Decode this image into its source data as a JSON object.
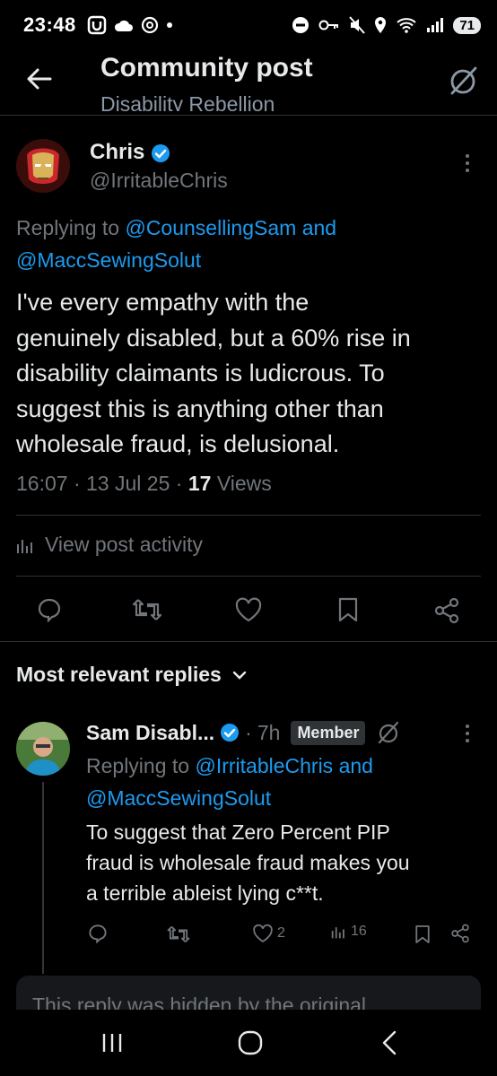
{
  "status_bar": {
    "time": "23:48",
    "battery": "71"
  },
  "header": {
    "title": "Community post",
    "subtitle": "Disability Rebellion"
  },
  "post": {
    "author_name": "Chris",
    "author_handle": "@IrritableChris",
    "replying_label": "Replying to",
    "replying_mention_1": "@CounsellingSam",
    "replying_and": "and",
    "replying_mention_2": "@MaccSewingSolut",
    "text_lines": [
      "I've every empathy with the",
      "genuinely disabled, but a 60% rise in",
      "disability claimants is ludicrous.  To",
      "suggest this is anything other than",
      "wholesale fraud, is delusional."
    ],
    "time": "16:07",
    "date": "13 Jul 25",
    "views_count": "17",
    "views_label": "Views",
    "sep": "·",
    "activity_label": "View post activity"
  },
  "replies_header": {
    "label": "Most relevant replies"
  },
  "reply": {
    "author_name": "Sam Disabl...",
    "sep": "·",
    "age": "7h",
    "badge": "Member",
    "replying_label": "Replying to",
    "replying_mention_1": "@IrritableChris",
    "replying_and": "and",
    "replying_mention_2": "@MaccSewingSolut",
    "text_lines": [
      "To suggest that Zero Percent PIP",
      "fraud is wholesale fraud makes you",
      "a terrible ableist lying c**t."
    ],
    "like_count": "2",
    "view_count": "16"
  },
  "hidden_reply": {
    "text": "This reply was hidden by the original"
  },
  "colors": {
    "accent": "#1d9bf0",
    "background": "#000000",
    "text": "#e7e9ea",
    "muted": "#71767b"
  }
}
